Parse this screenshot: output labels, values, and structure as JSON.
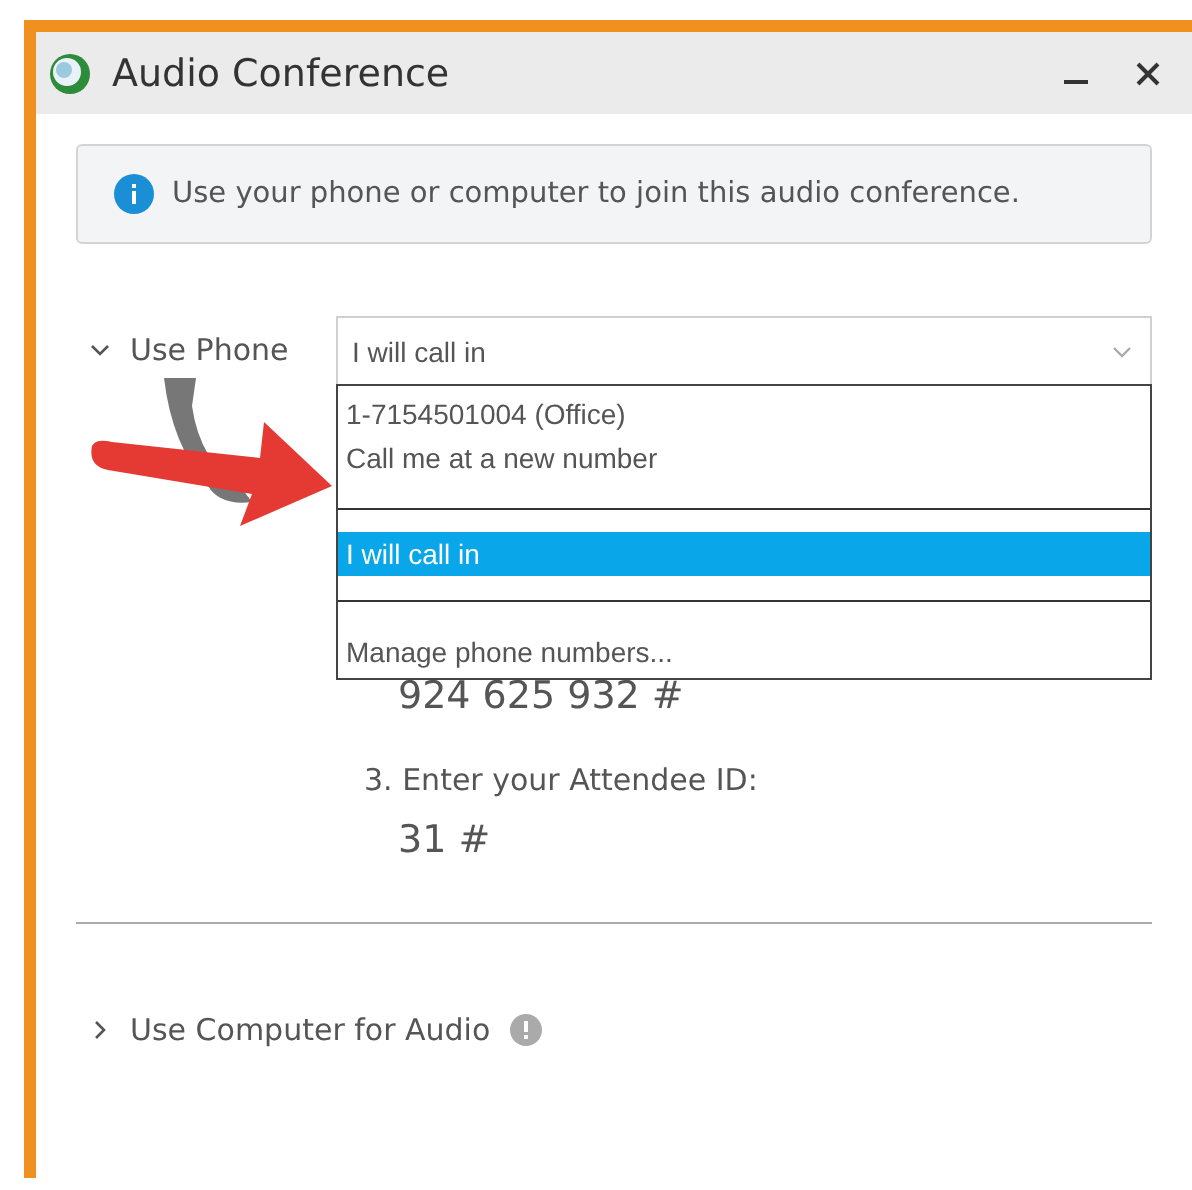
{
  "window": {
    "title": "Audio Conference"
  },
  "info_message": "Use your phone or computer to join this audio conference.",
  "use_phone": {
    "label": "Use Phone",
    "expanded": true
  },
  "dropdown": {
    "value": "I will call in",
    "open": true,
    "option_groups": [
      {
        "options": [
          {
            "label": "1-7154501004 (Office)",
            "selected": false
          },
          {
            "label": "Call me at a new number",
            "selected": false
          }
        ]
      },
      {
        "options": [
          {
            "label": "I will call in",
            "selected": true
          }
        ]
      },
      {
        "options": [
          {
            "label": "Manage phone numbers...",
            "selected": false
          }
        ]
      }
    ]
  },
  "access_code": "924 625 932 #",
  "attendee_label": "3. Enter your Attendee ID:",
  "attendee_id": "31 #",
  "use_computer": {
    "label": "Use Computer for Audio",
    "expanded": false
  }
}
